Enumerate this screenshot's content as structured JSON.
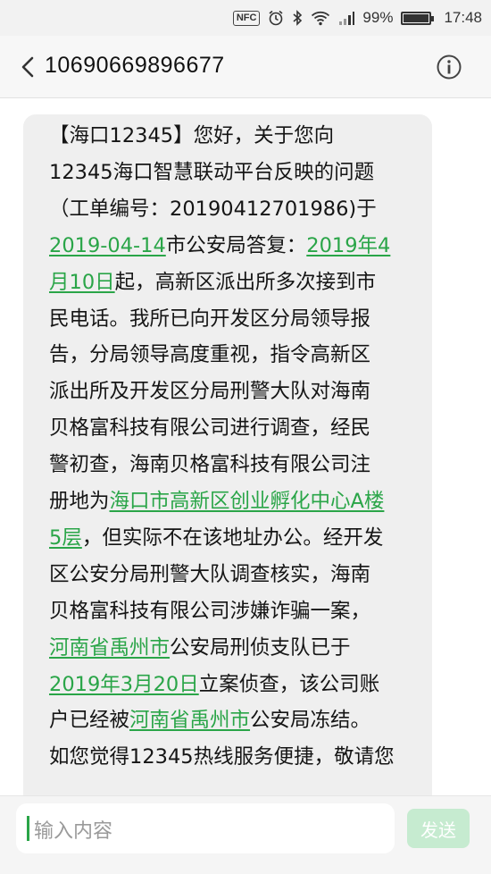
{
  "status_bar": {
    "nfc": "NFC",
    "battery_percent": "99%",
    "battery_level": 0.99,
    "time": "17:48",
    "icons": [
      "nfc-icon",
      "alarm-icon",
      "bluetooth-icon",
      "wifi-icon",
      "signal-icon",
      "battery-icon"
    ]
  },
  "header": {
    "contact": "10690669896677",
    "back_icon": "chevron-left-icon",
    "info_icon": "info-icon"
  },
  "message": {
    "lines": [
      [
        {
          "t": "【海口12345】您好，关于您向",
          "link": false
        }
      ],
      [
        {
          "t": "12345海口智慧联动平台反映的问题",
          "link": false
        }
      ],
      [
        {
          "t": "（工单编号：20190412701986)于",
          "link": false
        }
      ],
      [
        {
          "t": "2019-04-14",
          "link": true
        },
        {
          "t": "市公安局答复：",
          "link": false
        },
        {
          "t": "2019年4",
          "link": true
        }
      ],
      [
        {
          "t": "月10日",
          "link": true
        },
        {
          "t": "起，高新区派出所多次接到市",
          "link": false
        }
      ],
      [
        {
          "t": "民电话。我所已向开发区分局领导报",
          "link": false
        }
      ],
      [
        {
          "t": "告，分局领导高度重视，指令高新区",
          "link": false
        }
      ],
      [
        {
          "t": "派出所及开发区分局刑警大队对海南",
          "link": false
        }
      ],
      [
        {
          "t": "贝格富科技有限公司进行调查，经民",
          "link": false
        }
      ],
      [
        {
          "t": "警初查，海南贝格富科技有限公司注",
          "link": false
        }
      ],
      [
        {
          "t": "册地为",
          "link": false
        },
        {
          "t": "海口市高新区创业孵化中心A楼",
          "link": true
        }
      ],
      [
        {
          "t": "5层",
          "link": true
        },
        {
          "t": "，但实际不在该地址办公。经开发",
          "link": false
        }
      ],
      [
        {
          "t": "区公安分局刑警大队调查核实，海南",
          "link": false
        }
      ],
      [
        {
          "t": "贝格富科技有限公司涉嫌诈骗一案，",
          "link": false
        }
      ],
      [
        {
          "t": "河南省禹州市",
          "link": true
        },
        {
          "t": "公安局刑侦支队已于",
          "link": false
        }
      ],
      [
        {
          "t": "2019年3月20日",
          "link": true
        },
        {
          "t": "立案侦查，该公司账",
          "link": false
        }
      ],
      [
        {
          "t": "户已经被",
          "link": false
        },
        {
          "t": "河南省禹州市",
          "link": true
        },
        {
          "t": "公安局冻结。",
          "link": false
        }
      ],
      [
        {
          "t": "如您觉得12345热线服务便捷，敬请您",
          "link": false
        }
      ]
    ]
  },
  "input": {
    "placeholder": "输入内容",
    "send_label": "发送"
  },
  "colors": {
    "accent": "#2aa548",
    "bubble": "#efefef",
    "send_disabled": "#c6ebd0"
  }
}
